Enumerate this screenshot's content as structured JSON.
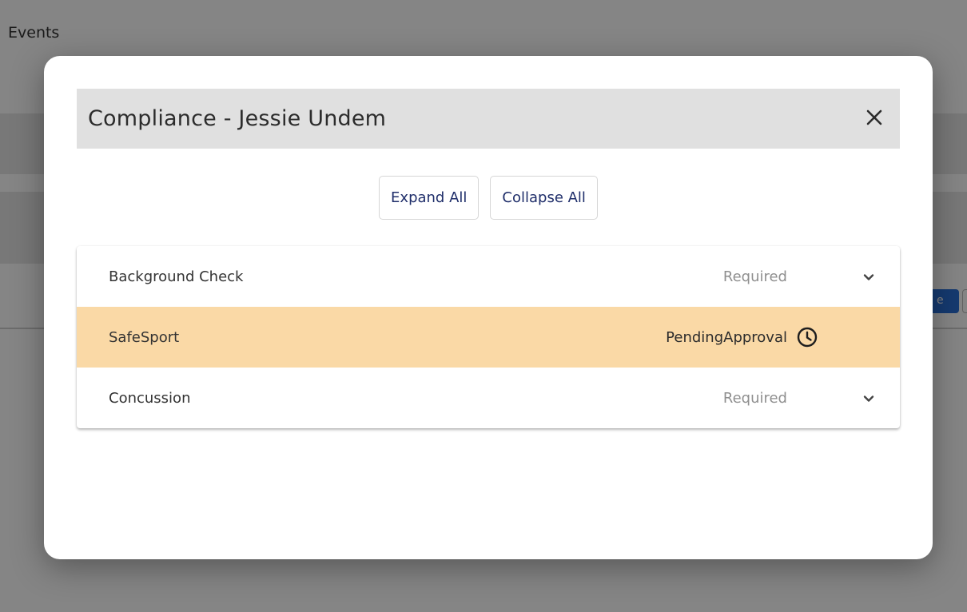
{
  "background": {
    "tab_label": "Events",
    "side_button_label": "e"
  },
  "modal": {
    "title": "Compliance - Jessie Undem",
    "close_icon": "close-icon",
    "expand_all_label": "Expand All",
    "collapse_all_label": "Collapse All",
    "items": [
      {
        "label": "Background Check",
        "status": "Required",
        "icon": "chevron-down-icon",
        "highlighted": false
      },
      {
        "label": "SafeSport",
        "status": "PendingApproval",
        "icon": "clock-icon",
        "highlighted": true,
        "highlight_color": "#fad9a6"
      },
      {
        "label": "Concussion",
        "status": "Required",
        "icon": "chevron-down-icon",
        "highlighted": false
      }
    ]
  },
  "colors": {
    "button_text": "#1f2e6a",
    "header_bg": "#e0e0e0",
    "pending_highlight": "#fad9a6",
    "accent_blue": "#2a6fd6"
  }
}
